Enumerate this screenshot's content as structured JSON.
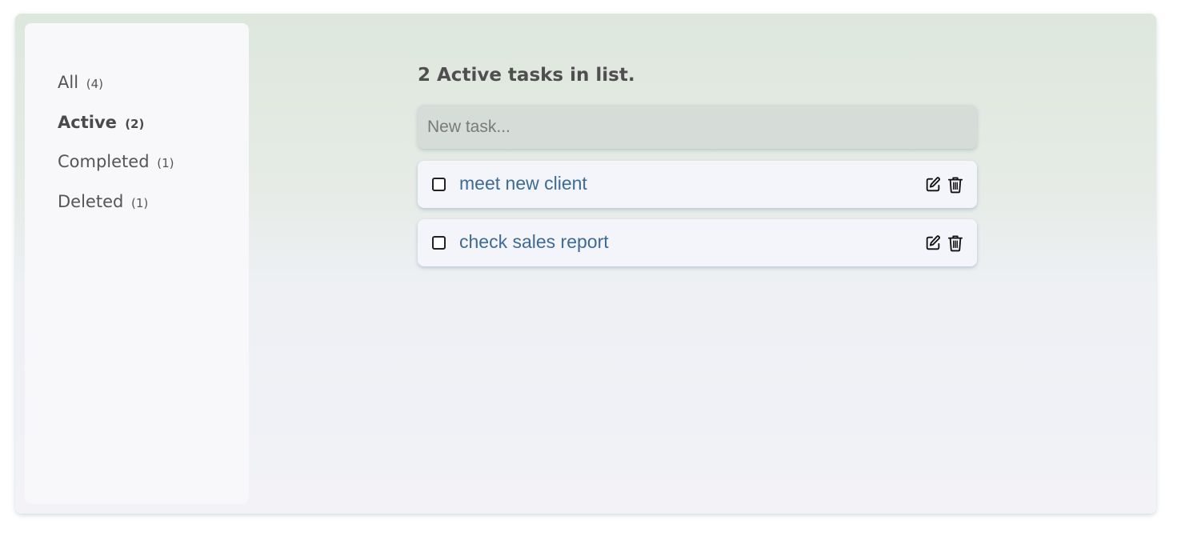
{
  "sidebar": {
    "items": [
      {
        "label": "All",
        "count": "(4)"
      },
      {
        "label": "Active",
        "count": "(2)"
      },
      {
        "label": "Completed",
        "count": "(1)"
      },
      {
        "label": "Deleted",
        "count": "(1)"
      }
    ],
    "selected": "Active"
  },
  "main": {
    "heading": "2 Active tasks in list.",
    "new_task_placeholder": "New task...",
    "tasks": [
      {
        "text": "meet new client",
        "done": false
      },
      {
        "text": "check sales report",
        "done": false
      }
    ]
  },
  "icons": {
    "edit": "pencil-square-icon",
    "delete": "trash-icon"
  },
  "colors": {
    "task_text": "#3e6b93",
    "heading": "#4f4f4f"
  }
}
